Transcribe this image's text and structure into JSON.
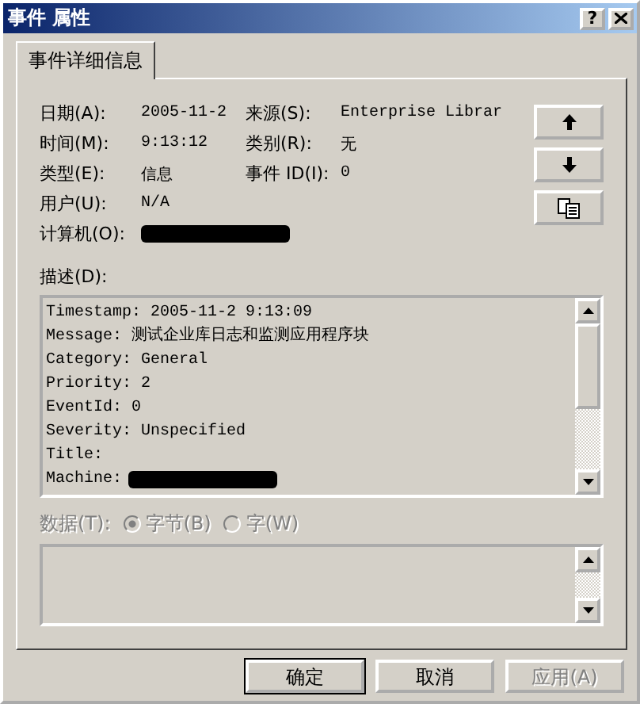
{
  "window": {
    "title": "事件 属性",
    "help": "?"
  },
  "tabs": [
    {
      "label": "事件详细信息",
      "selected": true
    }
  ],
  "fields": [
    {
      "label": "日期(A):",
      "value": "2005-11-2",
      "label2": "来源(S):",
      "value2": "Enterprise Librar"
    },
    {
      "label": "时间(M):",
      "value": "9:13:12",
      "label2": "类别(R):",
      "value2": "无"
    },
    {
      "label": "类型(E):",
      "value": "信息",
      "label2": "事件 ID(I):",
      "value2": "0"
    },
    {
      "label": "用户(U):",
      "value": "N/A"
    },
    {
      "label": "计算机(O):",
      "kind": "redacted"
    }
  ],
  "description": {
    "label": "描述(D):",
    "lines": [
      {
        "kind": "text",
        "text": "Timestamp: 2005-11-2 9:13:09"
      },
      {
        "kind": "text",
        "text": "Message: 测试企业库日志和监测应用程序块"
      },
      {
        "kind": "text",
        "text": "Category: General"
      },
      {
        "kind": "text",
        "text": "Priority: 2"
      },
      {
        "kind": "text",
        "text": "EventId: 0"
      },
      {
        "kind": "text",
        "text": "Severity: Unspecified"
      },
      {
        "kind": "text",
        "text": "Title:"
      },
      {
        "kind": "redacted",
        "text": "Machine:"
      }
    ]
  },
  "data": {
    "label": "数据(T):",
    "disabled": true,
    "options": [
      {
        "label": "字节(B)",
        "selected": true
      },
      {
        "label": "字(W)",
        "selected": false
      }
    ]
  },
  "buttons": [
    {
      "label": "确定",
      "default": true,
      "disabled": false
    },
    {
      "label": "取消",
      "default": false,
      "disabled": false
    },
    {
      "label": "应用(A)",
      "default": false,
      "disabled": true
    }
  ]
}
